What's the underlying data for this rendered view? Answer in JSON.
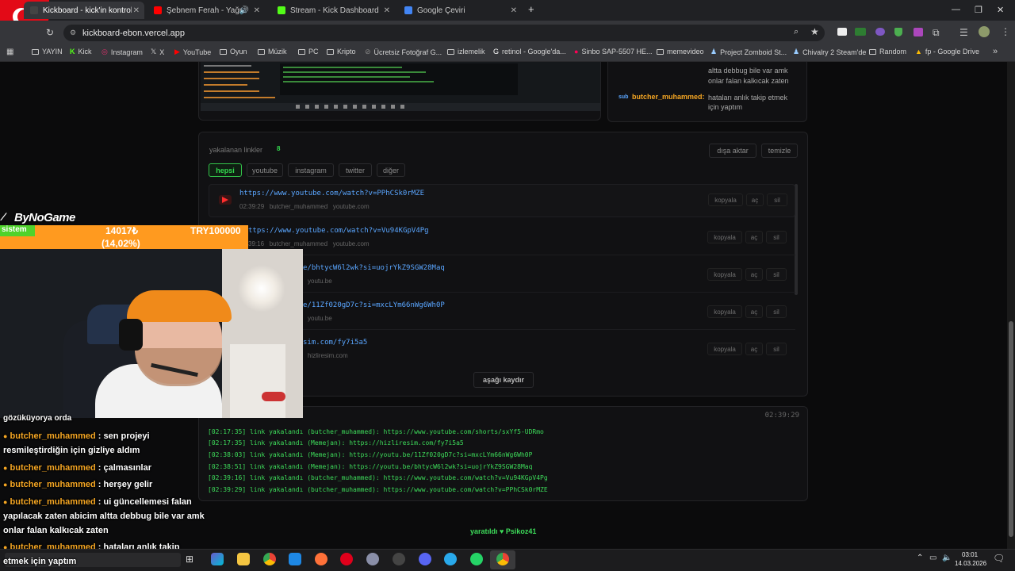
{
  "tabs": [
    {
      "label": "Kickboard - kick'in kontrol pan",
      "active": true
    },
    {
      "label": "Şebnem Ferah - Yağmurlar"
    },
    {
      "label": "Stream - Kick Dashboard"
    },
    {
      "label": "Google Çeviri"
    }
  ],
  "url": "kickboard-ebon.vercel.app",
  "bookmarks": [
    "YAYIN",
    "Kick",
    "Instagram",
    "X",
    "YouTube",
    "Oyun",
    "Müzik",
    "PC",
    "Kripto",
    "Ücretsiz Fotoğraf G...",
    "izlemelik",
    "retinol - Google'da...",
    "Sinbo SAP-5507 HE...",
    "memevideo",
    "Project Zomboid St...",
    "Chivalry 2 Steam'de",
    "Random",
    "fp - Google Drive"
  ],
  "top_chat": {
    "line1": "altta debbug bile var amk",
    "line2": "onlar falan kalkıcak zaten",
    "badge": "sub",
    "user": "butcher_muhammed:",
    "msg1": "hataları anlık takip etmek",
    "msg2": "için yaptım"
  },
  "links": {
    "title": "yakalanan linkler",
    "count": "8",
    "export_btn": "dışa aktar",
    "clear_btn": "temizle",
    "filters": [
      "hepsi",
      "youtube",
      "instagram",
      "twitter",
      "diğer"
    ],
    "rows": [
      {
        "url": "https://www.youtube.com/watch?v=PPhCSk0rMZE",
        "time": "02:39:29",
        "user": "butcher_muhammed",
        "domain": "youtube.com"
      },
      {
        "url": "ttps://www.youtube.com/watch?v=Vu94KGpV4Pg",
        "time": "39:16",
        "user": "butcher_muhammed",
        "domain": "youtube.com"
      },
      {
        "url": "e/bhtycW6l2wk?si=uojrYkZ9SGW28Maq",
        "time": "",
        "user": "",
        "domain": "youtu.be"
      },
      {
        "url": "e/11Zf020gD7c?si=mxcLYm66nWg6Wh0P",
        "time": "",
        "user": "",
        "domain": "youtu.be"
      },
      {
        "url": "sim.com/fy7i5a5",
        "time": "",
        "user": "",
        "domain": "hizliresim.com"
      }
    ],
    "row_buttons": [
      "kopyala",
      "aç",
      "sil"
    ],
    "scroll_btn": "aşağı kaydır"
  },
  "log": {
    "time": "02:39:29",
    "lines": [
      "[02:17:35] link yakalandı (butcher_muhammed): https://www.youtube.com/shorts/sxYf5-UDRmo",
      "[02:17:35] link yakalandı (Memejan): https://hizliresim.com/fy7i5a5",
      "[02:38:03] link yakalandı (Memejan): https://youtu.be/11Zf020gD7c?si=mxcLYm66nWg6Wh0P",
      "[02:38:51] link yakalandı (Memejan): https://youtu.be/bhtycW6l2wk?si=uojrYkZ9SGW28Maq",
      "[02:39:16] link yakalandı (butcher_muhammed): https://www.youtube.com/watch?v=Vu94KGpV4Pg",
      "[02:39:29] link yakalandı (butcher_muhammed): https://www.youtube.com/watch?v=PPhCSk0rMZE"
    ]
  },
  "footer": "yaratıldı ♥ Psikoz41",
  "overlay": {
    "brand": "ByNoGame",
    "bar_left": "sistem",
    "bar_mid1": "14017₺",
    "bar_mid2": "(14,02%)",
    "bar_right": "TRY100000",
    "progress_fraction": 0.1402
  },
  "stream_chat": [
    {
      "user": "",
      "msg": "gözüküyorya orda"
    },
    {
      "user": "butcher_muhammed",
      "msg": " : sen projeyi"
    },
    {
      "user": "",
      "msg": "resmileştirdiğin için gizliye aldım"
    },
    {
      "user": "butcher_muhammed",
      "msg": " : çalmasınlar"
    },
    {
      "user": "butcher_muhammed",
      "msg": " : herşey gelir"
    },
    {
      "user": "butcher_muhammed",
      "msg": " : ui güncellemesi falan"
    },
    {
      "user": "",
      "msg": "yapılacak zaten abicim altta debbug bile var amk"
    },
    {
      "user": "",
      "msg": "onlar falan kalkıcak zaten"
    },
    {
      "user": "butcher_muhammed",
      "msg": " : hataları anlık takip"
    },
    {
      "user": "",
      "msg": "etmek için yaptım"
    }
  ],
  "clock": {
    "time": "03:01",
    "date": "14.03.2026"
  }
}
